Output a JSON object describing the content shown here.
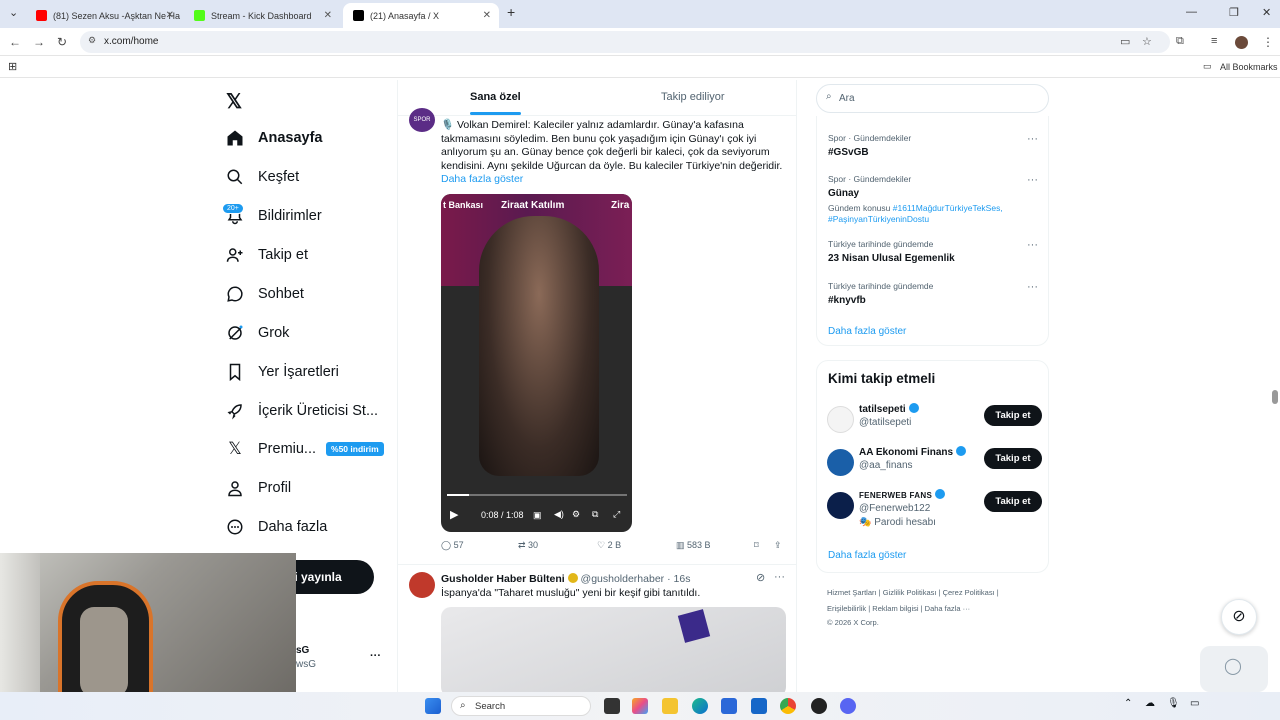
{
  "browser": {
    "tabs": [
      {
        "label": "(81) Sezen Aksu -Aşktan Ne Ha",
        "color": "#ff0000"
      },
      {
        "label": "Stream - Kick Dashboard",
        "color": "#53fc18"
      },
      {
        "label": "(21) Anasayfa / X",
        "color": "#000000"
      }
    ],
    "url": "x.com/home",
    "bookmarks_label": "All Bookmarks"
  },
  "nav": {
    "items": [
      {
        "label": "Anasayfa",
        "icon": "home-icon"
      },
      {
        "label": "Keşfet",
        "icon": "search-icon"
      },
      {
        "label": "Bildirimler",
        "icon": "bell-icon",
        "badge": "20+"
      },
      {
        "label": "Takip et",
        "icon": "follow-icon"
      },
      {
        "label": "Sohbet",
        "icon": "chat-icon"
      },
      {
        "label": "Grok",
        "icon": "grok-icon"
      },
      {
        "label": "Yer İşaretleri",
        "icon": "bookmark-icon"
      },
      {
        "label": "İçerik Üreticisi St...",
        "icon": "rocket-icon"
      },
      {
        "label": "Premiu...",
        "icon": "x-icon",
        "promo": "%50 indirim"
      },
      {
        "label": "Profil",
        "icon": "person-icon"
      },
      {
        "label": "Daha fazla",
        "icon": "more-icon"
      }
    ],
    "post_button": "i yayınla",
    "account_name": "sG",
    "account_handle": "wsG"
  },
  "feed": {
    "tab_for_you": "Sana özel",
    "tab_following": "Takip ediliyor",
    "tweet1": {
      "text": "🎙️ Volkan Demirel: Kaleciler yalnız adamlardır. Günay'a kafasına takmamasını söyledim. Ben bunu çok yaşadığım için Günay'ı çok iyi anlıyorum şu an. Günay bence çok değerli bir kaleci, çok da seviyorum kendisini. Aynı şekilde Uğurcan da öyle. Bu kaleciler Türkiye'nin değeridir.",
      "show_more": "Daha fazla göster",
      "video_time": "0:08 / 1:08",
      "video_progress": 0.12,
      "replies": "57",
      "reposts": "30",
      "likes": "2 B",
      "views": "583 B",
      "banner_texts": [
        "t Bankası",
        "Ziraat Katılım",
        "Zira"
      ]
    },
    "tweet2": {
      "name": "Gusholder Haber Bülteni",
      "handle": "@gusholderhaber",
      "time": "16s",
      "text": "İspanya'da \"Taharet musluğu\" yeni bir keşif gibi tanıtıldı."
    }
  },
  "sidebar": {
    "search_placeholder": "Ara",
    "trends": [
      {
        "meta": "Spor · Gündemdekiler",
        "name": "#GSvGB"
      },
      {
        "meta": "Spor · Gündemdekiler",
        "name": "Günay",
        "topic_label": "Gündem konusu",
        "topic_tags": "#1611MağdurTürkiyeTekSes, #PaşinyanTürkiyeninDostu"
      },
      {
        "meta": "Türkiye tarihinde gündemde",
        "name": "23 Nisan Ulusal Egemenlik"
      },
      {
        "meta": "Türkiye tarihinde gündemde",
        "name": "#knyvfb"
      }
    ],
    "trends_show_more": "Daha fazla göster",
    "who_to_follow_title": "Kimi takip etmeli",
    "accounts": [
      {
        "name": "tatilsepeti",
        "handle": "@tatilsepeti",
        "button": "Takip et"
      },
      {
        "name": "AA Ekonomi Finans",
        "handle": "@aa_finans",
        "button": "Takip et"
      },
      {
        "name": "FENERWEB FANS",
        "handle": "@Fenerweb122",
        "note": "Parodi hesabı",
        "button": "Takip et"
      }
    ],
    "follow_show_more": "Daha fazla göster",
    "footer_line1": "Hizmet Şartları  |  Gizlilik Politikası  |  Çerez Politikası  |",
    "footer_line2": "Erişilebilirlik  |  Reklam bilgisi  |  Daha fazla ···",
    "footer_line3": "© 2026 X Corp."
  },
  "taskbar": {
    "search_label": "Search"
  }
}
